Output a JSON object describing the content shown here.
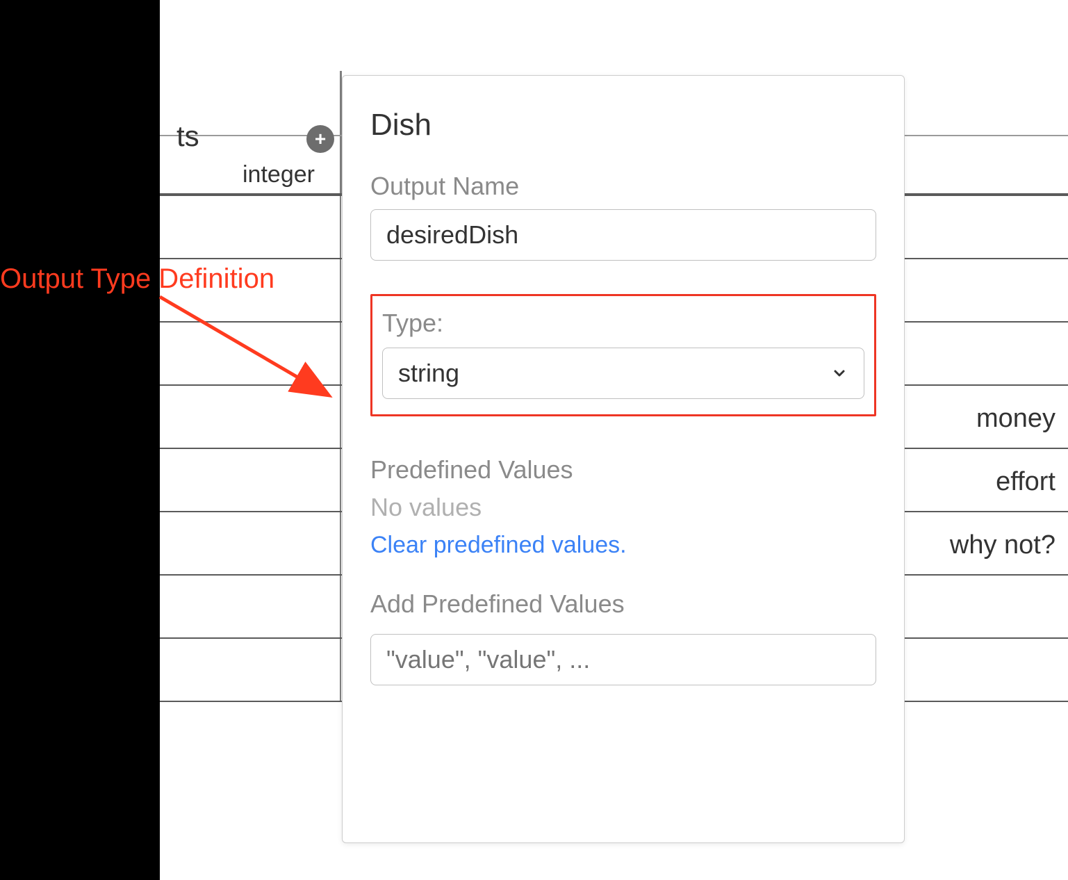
{
  "annotation": {
    "text": "Output Type Definition"
  },
  "background": {
    "header_suffix": "ts",
    "col_type": "integer",
    "row_values": [
      "",
      "",
      "",
      "money",
      "effort",
      "why not?",
      "",
      ""
    ]
  },
  "panel": {
    "title": "Dish",
    "output_name": {
      "label": "Output Name",
      "value": "desiredDish"
    },
    "type": {
      "label": "Type:",
      "value": "string"
    },
    "predefined": {
      "label": "Predefined Values",
      "empty_text": "No values",
      "clear_link": "Clear predefined values."
    },
    "add_predefined": {
      "label": "Add Predefined Values",
      "placeholder": "\"value\", \"value\", ..."
    }
  }
}
